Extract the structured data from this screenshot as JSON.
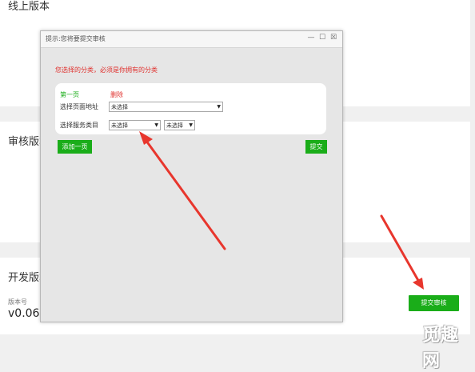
{
  "background_page": {
    "sections": [
      {
        "title": "线上版本"
      },
      {
        "title": "审核版本"
      },
      {
        "title": "开发版本"
      }
    ],
    "version_label": "版本号",
    "version_value": "v0.06",
    "submit_review_button": "提交审核"
  },
  "dialog": {
    "title": "提示:您将要提交审核",
    "controls": {
      "minimize": "—",
      "maximize": "☐",
      "close": "☒"
    },
    "notice": "您选择的分类，必须是你拥有的分类",
    "page_label": "第一页",
    "delete_link": "删除",
    "page_address_label": "选择页面地址",
    "service_category_label": "选择服务类目",
    "page_select_value": "未选择",
    "category_select_1_value": "未选择",
    "category_select_2_value": "未选择",
    "add_page_button": "添加一页",
    "submit_button": "提交"
  },
  "watermark": "觅趣网",
  "colors": {
    "accent_green": "#1aad19",
    "warning_red": "#e0302d",
    "arrow_red": "#e8362d"
  }
}
